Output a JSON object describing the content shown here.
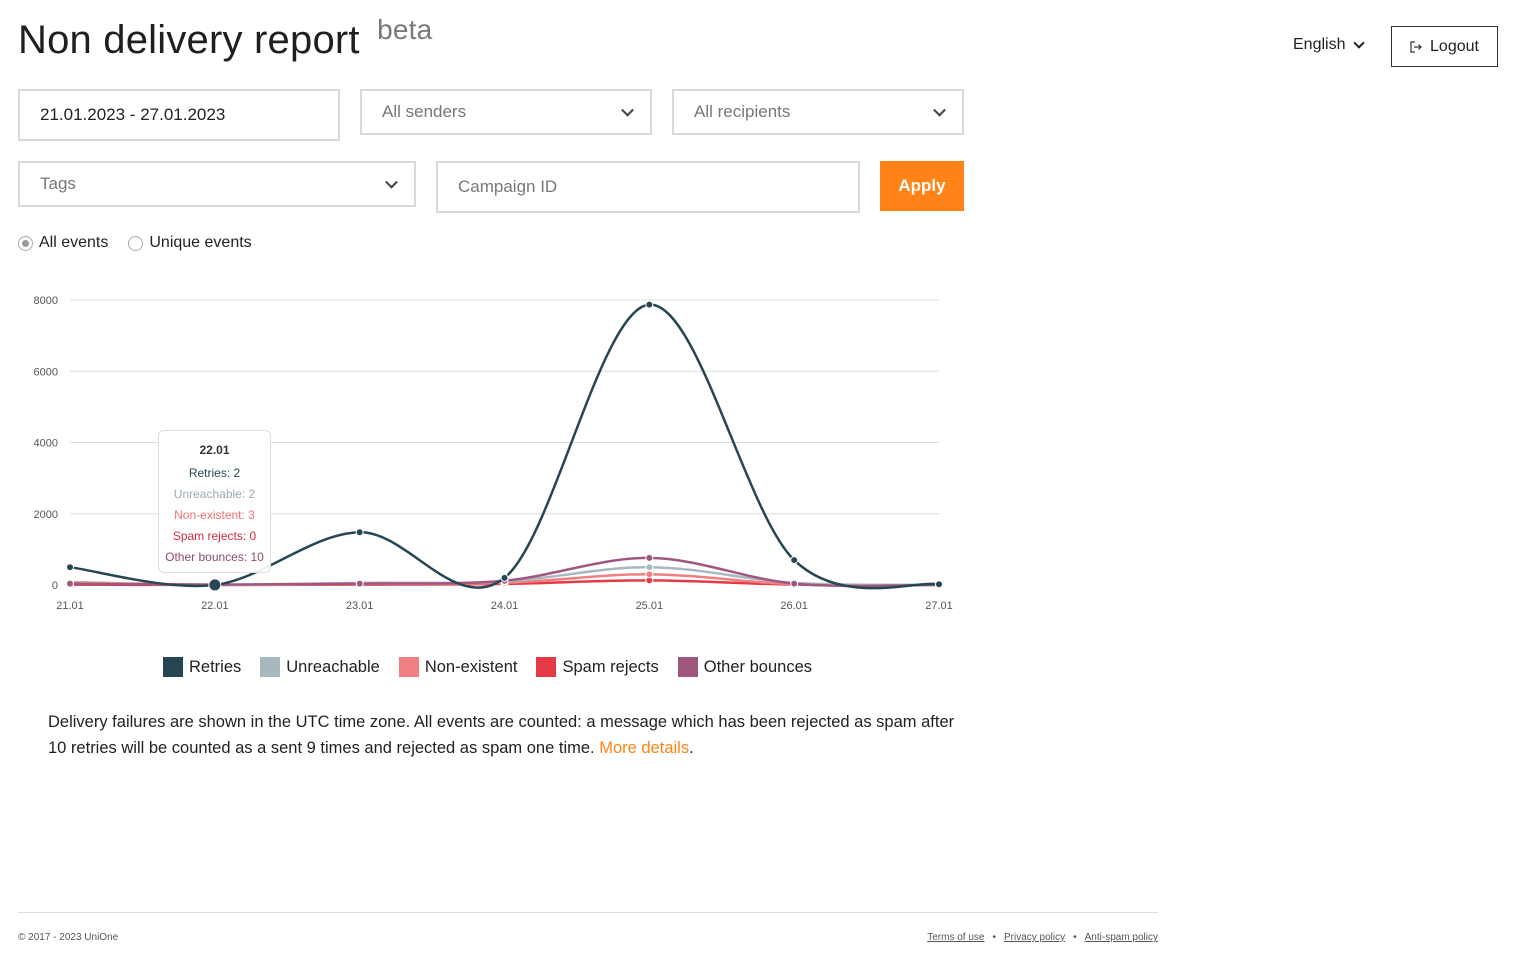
{
  "header": {
    "title": "Non delivery report",
    "badge": "beta",
    "language": "English",
    "logout_label": "Logout"
  },
  "filters": {
    "date_range": "21.01.2023 - 27.01.2023",
    "senders": "All senders",
    "recipients": "All recipients",
    "tags_placeholder": "Tags",
    "campaign_placeholder": "Campaign ID",
    "apply_label": "Apply"
  },
  "event_mode": {
    "options": [
      "All events",
      "Unique events"
    ],
    "selected": "All events"
  },
  "chart_data": {
    "type": "line",
    "x": [
      "21.01",
      "22.01",
      "23.01",
      "24.01",
      "25.01",
      "26.01",
      "27.01"
    ],
    "ylim": [
      0,
      8000
    ],
    "yticks": [
      0,
      2000,
      4000,
      6000,
      8000
    ],
    "grid": true,
    "legend": "bottom",
    "series": [
      {
        "name": "Retries",
        "color": "#264653",
        "values": [
          500,
          2,
          1480,
          200,
          7870,
          700,
          20
        ]
      },
      {
        "name": "Unreachable",
        "color": "#a8b8bf",
        "values": [
          60,
          2,
          60,
          100,
          500,
          60,
          5
        ]
      },
      {
        "name": "Non-existent",
        "color": "#f08080",
        "values": [
          80,
          3,
          30,
          60,
          300,
          20,
          3
        ]
      },
      {
        "name": "Spam rejects",
        "color": "#e63946",
        "values": [
          10,
          0,
          10,
          30,
          130,
          10,
          0
        ]
      },
      {
        "name": "Other bounces",
        "color": "#a0577f",
        "values": [
          40,
          10,
          40,
          120,
          760,
          40,
          5
        ]
      }
    ],
    "tooltip": {
      "date": "22.01",
      "lines": [
        "Retries: 2",
        "Unreachable: 2",
        "Non-existent: 3",
        "Spam rejects: 0",
        "Other bounces: 10"
      ]
    }
  },
  "note": {
    "text": "Delivery failures are shown in the UTC time zone. All events are counted: a message which has been rejected as spam after 10 retries will be counted as a sent 9 times and rejected as spam one time. ",
    "link": "More details",
    "tail": "."
  },
  "footer": {
    "copyright": "© 2017 - 2023 UniOne",
    "links": [
      "Terms of use",
      "Privacy policy",
      "Anti-spam policy"
    ]
  }
}
